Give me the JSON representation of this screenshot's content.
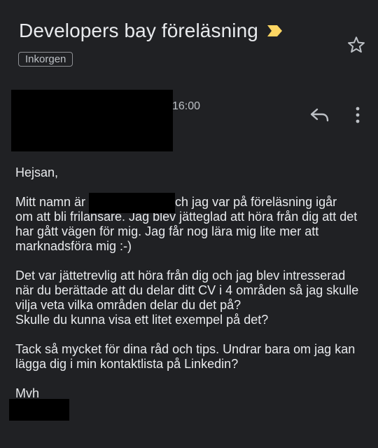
{
  "email": {
    "subject": "Developers bay föreläsning",
    "label": "Inkorgen",
    "time": "16:00",
    "greeting": "Hejsan,",
    "p1_line1_start": "Mitt namn är ",
    "p1_line1_end": " och jag var på föreläsning igår",
    "p1_line2": "om att bli frilansare. Jag blev jätteglad att höra från dig att det",
    "p1_line3": "har gått vägen för mig. Jag får nog lära mig lite mer att",
    "p1_line4": "marknadsföra mig :-)",
    "p2_line1": "Det var jättetrevlig att höra från dig och jag blev intresserad",
    "p2_line2": "när du berättade att du delar ditt CV i 4 områden så jag skulle",
    "p2_line3": "vilja veta vilka områden delar du det på?",
    "p2_line4": "Skulle du kunna visa ett litet exempel på det?",
    "p3_line1": "Tack så mycket för dina råd och tips. Undrar bara om jag kan",
    "p3_line2": "lägga dig i min kontaktlista på Linkedin?",
    "signoff": "Mvh"
  },
  "colors": {
    "background": "#202124",
    "text": "#e8eaed",
    "importance_marker": "#fdd663"
  },
  "icons": {
    "importance": "importance-marker-icon",
    "star": "star-outline-icon",
    "reply": "reply-arrow-icon",
    "more": "vertical-dots-icon"
  }
}
